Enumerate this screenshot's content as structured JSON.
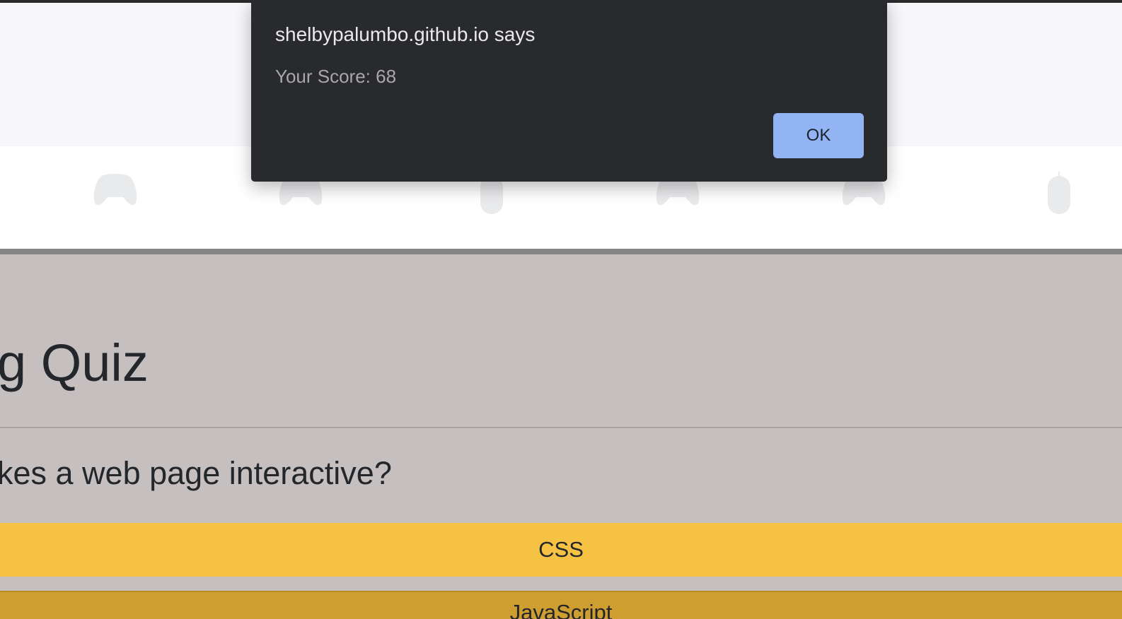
{
  "alert": {
    "title": "shelbypalumbo.github.io says",
    "message": "Your Score: 68",
    "ok_label": "OK"
  },
  "header": {
    "icons": [
      "gamepad-icon",
      "gamepad-icon",
      "mouse-icon",
      "gamepad-icon",
      "gamepad-icon",
      "mouse-icon"
    ]
  },
  "quiz": {
    "title": "g Quiz",
    "question": "kes a web page interactive?",
    "answers": [
      {
        "label": "CSS"
      },
      {
        "label": "JavaScript"
      }
    ]
  },
  "colors": {
    "alert_bg": "#292a2e",
    "ok_button": "#92b4f3",
    "answer_primary": "#f5c244",
    "answer_secondary": "#cf9e31",
    "quiz_bg": "#c6bfbf"
  }
}
